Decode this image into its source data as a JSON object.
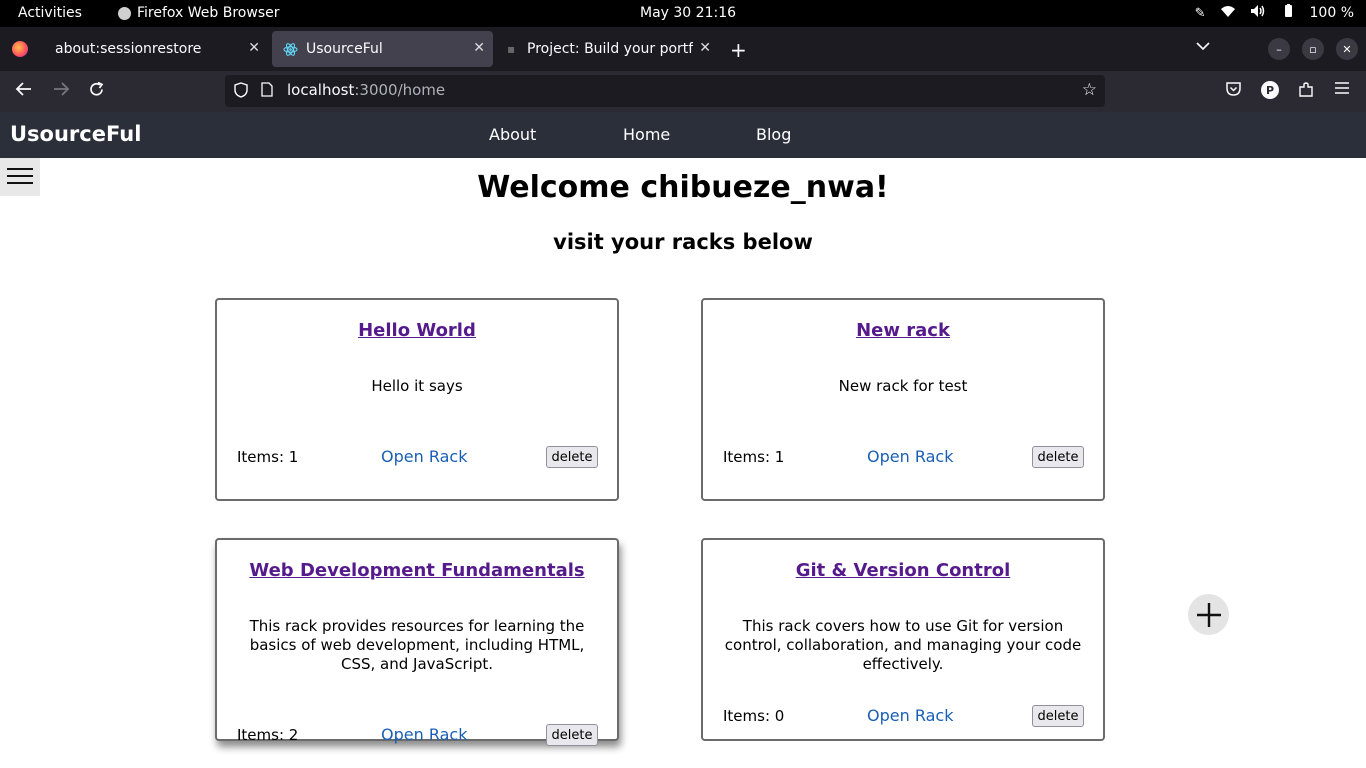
{
  "system_bar": {
    "activities": "Activities",
    "app_name": "Firefox Web Browser",
    "clock": "May 30  21:16",
    "battery": "100 %"
  },
  "browser": {
    "tabs": [
      {
        "label": "about:sessionrestore"
      },
      {
        "label": "UsourceFul"
      },
      {
        "label": "Project: Build your portfo"
      }
    ],
    "url_host": "localhost",
    "url_path": ":3000/home",
    "profile_initial": "P"
  },
  "app": {
    "brand": "UsourceFul",
    "nav": [
      "About",
      "Home",
      "Blog"
    ],
    "welcome": "Welcome chibueze_nwa!",
    "subtitle": "visit your racks below",
    "open_label": "Open Rack",
    "delete_label": "delete",
    "racks": [
      {
        "title": "Hello World",
        "description": "Hello it says",
        "items": "Items: 1"
      },
      {
        "title": "New rack",
        "description": "New rack for test",
        "items": "Items: 1"
      },
      {
        "title": "Web Development Fundamentals",
        "description": "This rack provides resources for learning the basics of web development, including HTML, CSS, and JavaScript.",
        "items": "Items: 2"
      },
      {
        "title": "Git & Version Control",
        "description": "This rack covers how to use Git for version control, collaboration, and managing your code effectively.",
        "items": "Items: 0"
      }
    ]
  }
}
